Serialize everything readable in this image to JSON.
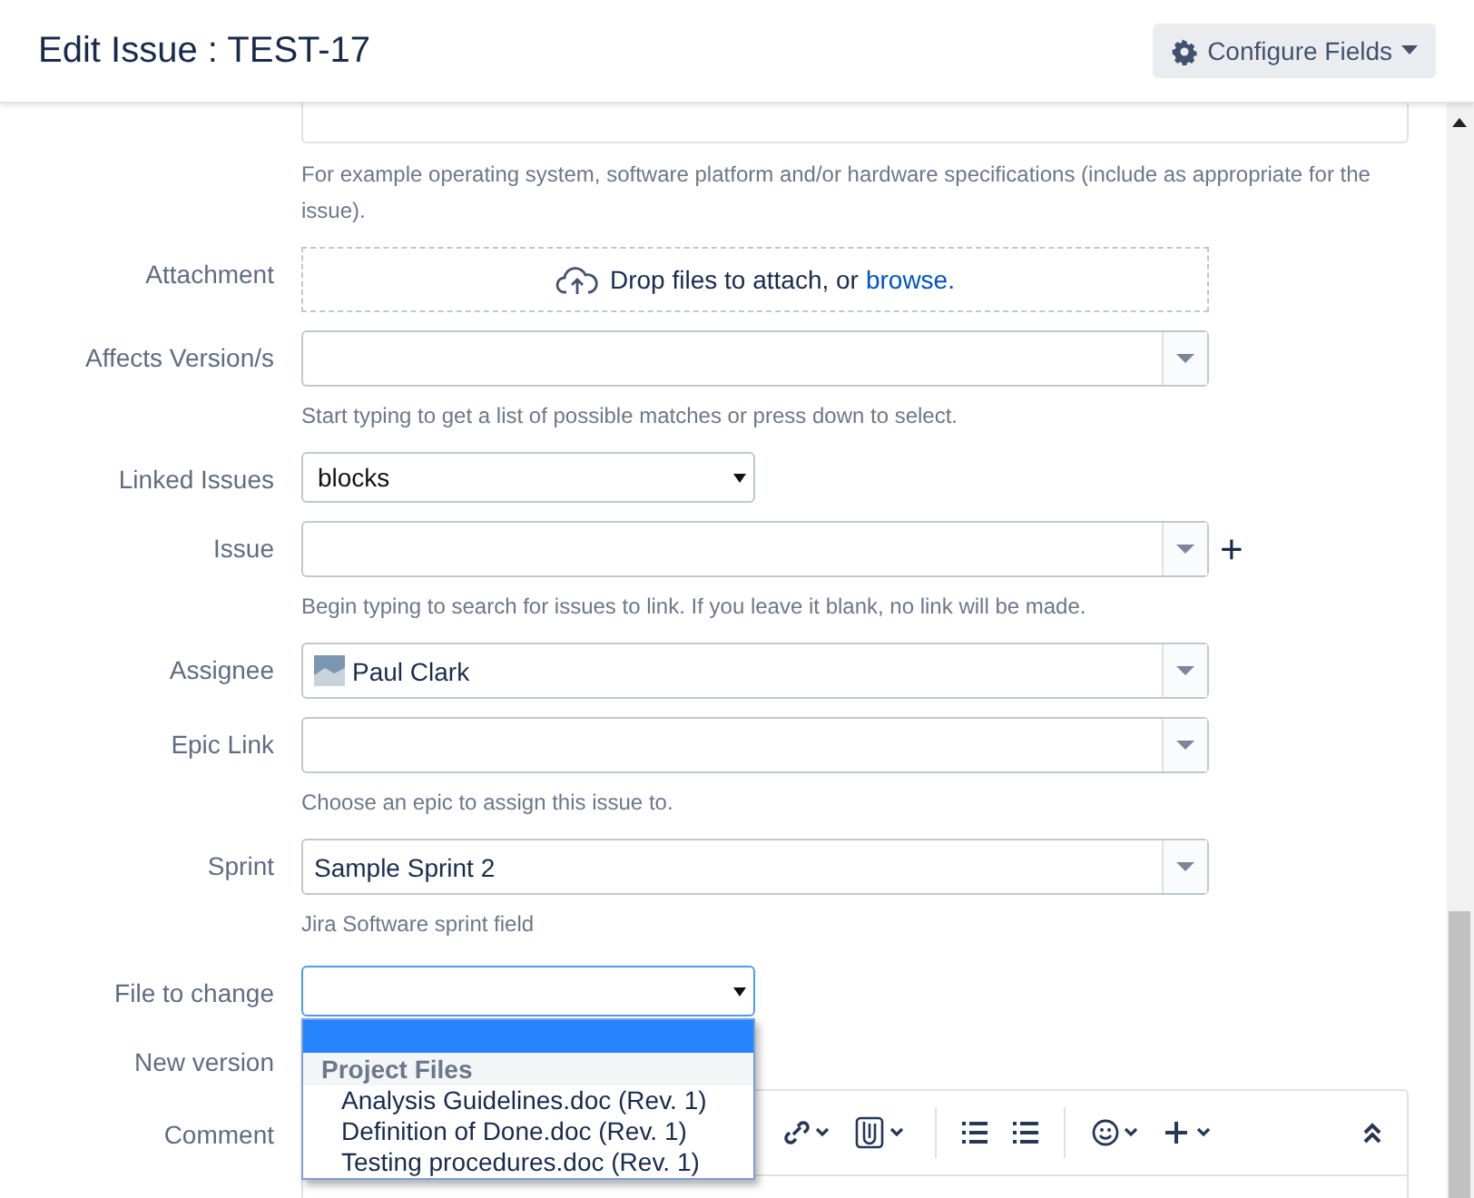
{
  "dialog": {
    "title": "Edit Issue : TEST-17",
    "configure_button": "Configure Fields"
  },
  "top_help": "For example operating system, software platform and/or hardware specifications (include as appropriate for the issue).",
  "fields": [
    {
      "kind": "attachment",
      "label": "Attachment",
      "text": "Drop files to attach, or",
      "link": "browse."
    },
    {
      "kind": "select",
      "label": "Affects Version/s",
      "help": "Start typing to get a list of possible matches or press down to select."
    },
    {
      "kind": "native",
      "label": "Linked Issues",
      "value": "blocks"
    },
    {
      "kind": "select",
      "label": "Issue",
      "help": "Begin typing to search for issues to link. If you leave it blank, no link will be made.",
      "plus": "+"
    },
    {
      "kind": "user",
      "label": "Assignee",
      "value": "Paul Clark"
    },
    {
      "kind": "select",
      "label": "Epic Link",
      "help": "Choose an epic to assign this issue to."
    },
    {
      "kind": "select",
      "label": "Sprint",
      "value": "Sample Sprint 2",
      "help": "Jira Software sprint field"
    },
    {
      "kind": "open",
      "label": "File to change",
      "group": "Project Files",
      "options": [
        {
          "selected": true
        },
        {
          "label": "Analysis Guidelines.doc (Rev. 1)",
          "selected": false
        },
        {
          "label": "Definition of Done.doc (Rev. 1)",
          "selected": false
        },
        {
          "label": "Testing procedures.doc (Rev. 1)",
          "selected": false
        }
      ]
    },
    {
      "kind": "hidden",
      "label": "New version"
    },
    {
      "kind": "comment",
      "label": "Comment"
    }
  ]
}
